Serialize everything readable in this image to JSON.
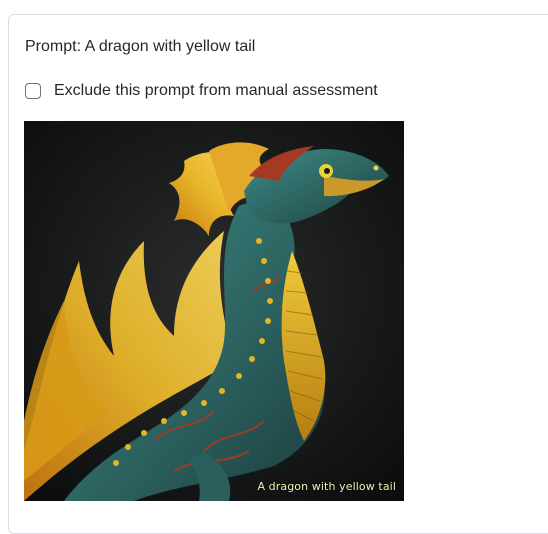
{
  "prompt": {
    "text": "Prompt: A dragon with yellow tail"
  },
  "exclude": {
    "label": "Exclude this prompt from manual assessment",
    "checked": false
  },
  "image": {
    "caption": "A dragon with yellow tail",
    "subject": "dragon-image"
  },
  "colors": {
    "card_border": "#dadce0",
    "text": "#262730",
    "image_background": "#0f1113",
    "dragon_teal": "#2f6f6c",
    "dragon_yellow": "#e3b622",
    "dragon_red": "#9b2d1d"
  }
}
